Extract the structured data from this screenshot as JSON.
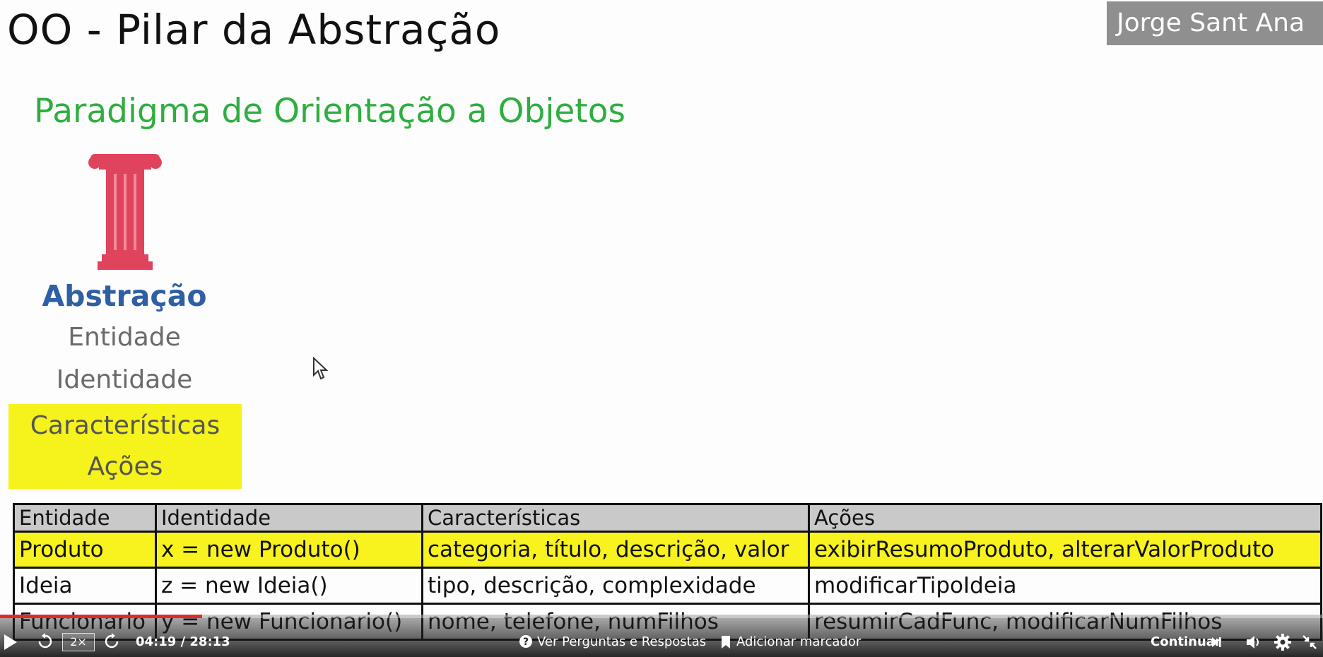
{
  "slide": {
    "title": "OO - Pilar da Abstração",
    "author": "Jorge Sant Ana",
    "subtitle": "Paradigma de Orientação a Objetos",
    "pillar_items": {
      "main": "Abstração",
      "item1": "Entidade",
      "item2": "Identidade",
      "item3": "Características",
      "item4": "Ações"
    },
    "colors": {
      "subtitle": "#2eae3f",
      "pillar": "#e0445c",
      "highlight": "#f5f21c",
      "main_item": "#2f5fa4"
    },
    "table": {
      "headers": [
        "Entidade",
        "Identidade",
        "Características",
        "Ações"
      ],
      "rows": [
        [
          "Produto",
          "x = new Produto()",
          "categoria, título, descrição, valor",
          "exibirResumoProduto, alterarValorProduto"
        ],
        [
          "Ideia",
          "z = new Ideia()",
          "tipo, descrição, complexidade",
          "modificarTipoIdeia"
        ],
        [
          "Funcionario",
          "y = new Funcionario()",
          "nome, telefone, numFilhos",
          "resumirCadFunc, modificarNumFilhos"
        ]
      ]
    }
  },
  "player": {
    "speed_label": "2×",
    "time": "04:19 / 28:13",
    "progress": 0.153,
    "qa_label": "Ver Perguntas e Respostas",
    "bookmark_label": "Adicionar marcador",
    "continue_label": "Continuar",
    "progress_color": "#e02a2a"
  }
}
